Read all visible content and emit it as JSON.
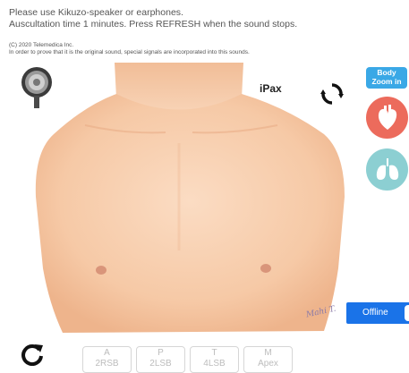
{
  "instructions": {
    "line1": "Please use Kikuzo-speaker or earphones.",
    "line2": "Auscultation time 1 minutes. Press REFRESH when the sound stops."
  },
  "copyright": {
    "line1": "(C) 2020 Telemedica Inc.",
    "line2": "In order to prove that it is the original sound, special signals are incorporated into this sounds."
  },
  "viewer": {
    "brand": "iPax",
    "signature": "Mahi T.",
    "zoom_label_line1": "Body",
    "zoom_label_line2": "Zoom in",
    "offline_label": "Offline"
  },
  "auscultation_points": [
    {
      "top": "A",
      "bottom": "2RSB"
    },
    {
      "top": "P",
      "bottom": "2LSB"
    },
    {
      "top": "T",
      "bottom": "4LSB"
    },
    {
      "top": "M",
      "bottom": "Apex"
    }
  ],
  "icons": {
    "stethoscope": "stethoscope-icon",
    "rotate": "rotate-icon",
    "heart": "heart-icon",
    "lungs": "lungs-icon",
    "refresh": "refresh-icon"
  },
  "colors": {
    "zoom": "#3aa8e6",
    "heart": "#ec6b5c",
    "lungs": "#8ccfd2",
    "offline": "#1a73e8",
    "skin": "#f6c9a6"
  }
}
